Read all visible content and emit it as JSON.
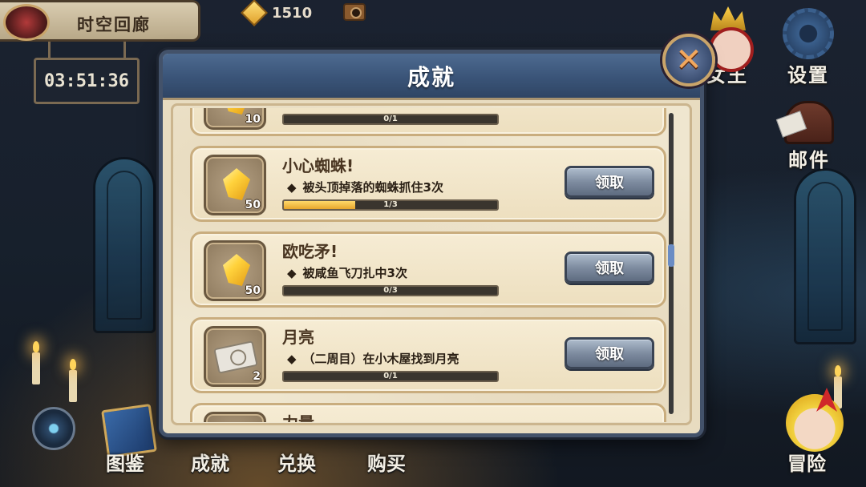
{
  "header": {
    "location": "时空回廊",
    "timer": "03:51:36",
    "gems": "1510"
  },
  "side_menu": [
    {
      "label": "女王",
      "icon": "queen-icon"
    },
    {
      "label": "设置",
      "icon": "gear-icon"
    },
    {
      "label": "邮件",
      "icon": "mailbox-icon"
    }
  ],
  "bottom_nav": [
    {
      "label": "图鉴",
      "icon": "book-icon"
    },
    {
      "label": "成就",
      "icon": ""
    },
    {
      "label": "兑换",
      "icon": ""
    },
    {
      "label": "购买",
      "icon": ""
    },
    {
      "label": "冒险",
      "icon": "hero-avatar-icon"
    }
  ],
  "dialog": {
    "title": "成就",
    "close_label": "✕",
    "scroll_position": 0.47,
    "items": [
      {
        "title": "",
        "reward_icon": "gem-icon",
        "reward_count": "10",
        "description": "",
        "progress_text": "0/1",
        "progress": 0.0,
        "button": ""
      },
      {
        "title": "小心蜘蛛!",
        "reward_icon": "gem-icon",
        "reward_count": "50",
        "description": "被头顶掉落的蜘蛛抓住3次",
        "progress_text": "1/3",
        "progress": 0.333,
        "button": "领取"
      },
      {
        "title": "欧吃矛!",
        "reward_icon": "gem-icon",
        "reward_count": "50",
        "description": "被咸鱼飞刀扎中3次",
        "progress_text": "0/3",
        "progress": 0.0,
        "button": "领取"
      },
      {
        "title": "月亮",
        "reward_icon": "ticket-icon",
        "reward_count": "2",
        "description": "（二周目）在小木屋找到月亮",
        "progress_text": "0/1",
        "progress": 0.0,
        "button": "领取"
      },
      {
        "title": "力量",
        "reward_icon": "gem-icon",
        "reward_count": "",
        "description": "",
        "progress_text": "",
        "progress": 0.0,
        "button": ""
      }
    ]
  }
}
